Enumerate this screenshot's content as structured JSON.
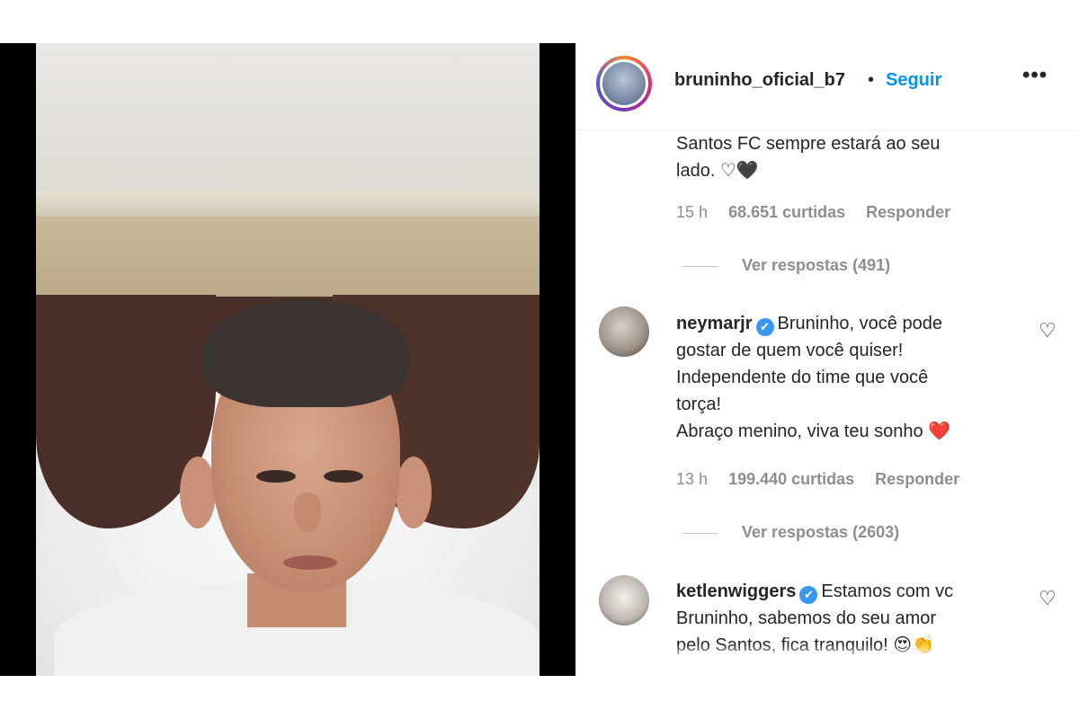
{
  "post": {
    "username": "bruninho_oficial_b7",
    "separator": "•",
    "follow_label": "Seguir",
    "more_icon": "•••"
  },
  "comments": [
    {
      "text_lines": [
        "Santos FC sempre estará ao seu",
        "lado. ♡🖤"
      ],
      "time": "15 h",
      "likes": "68.651 curtidas",
      "reply_label": "Responder",
      "view_replies": "Ver respostas (491)"
    },
    {
      "username": "neymarjr",
      "verified": "✔",
      "text_lines": [
        "Bruninho, você pode",
        "gostar de quem você quiser!",
        "Independente do time que você",
        "torça!",
        "Abraço menino, viva teu sonho ❤️"
      ],
      "time": "13 h",
      "likes": "199.440 curtidas",
      "reply_label": "Responder",
      "view_replies": "Ver respostas (2603)",
      "like_icon": "♡"
    },
    {
      "username": "ketlenwiggers",
      "verified": "✔",
      "text_lines": [
        "Estamos com vc",
        "Bruninho, sabemos do seu amor",
        "pelo Santos, fica tranquilo! 😍👏"
      ],
      "like_icon": "♡"
    }
  ]
}
